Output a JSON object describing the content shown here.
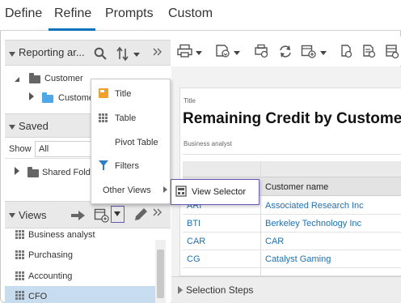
{
  "tabs": [
    "Define",
    "Refine",
    "Prompts",
    "Custom"
  ],
  "active_tab": "Refine",
  "left_panel": {
    "reporting_area": {
      "title": "Reporting ar...",
      "tree": [
        {
          "label": "Customer",
          "icon": "folder-icon"
        },
        {
          "label": "Custome",
          "icon": "folder-blue-icon"
        }
      ]
    },
    "saved": {
      "title": "Saved",
      "show_label": "Show",
      "show_value": "All",
      "tree": [
        {
          "label": "Shared Folde",
          "icon": "folder-icon"
        }
      ]
    },
    "views": {
      "title": "Views",
      "items": [
        "Business analyst",
        "Purchasing",
        "Accounting",
        "CFO"
      ],
      "selected": "CFO"
    }
  },
  "add_view_menu": {
    "items": [
      "Title",
      "Table",
      "Pivot Table",
      "Filters",
      "Other Views"
    ],
    "submenu": {
      "items": [
        "View Selector"
      ]
    }
  },
  "report": {
    "title_label": "Title",
    "title": "Remaining Credit by Customer",
    "subtitle": "Business analyst",
    "column_header": "Customer name",
    "rows": [
      {
        "code": "ARI",
        "name": "Associated Research Inc"
      },
      {
        "code": "BTI",
        "name": "Berkeley Technology Inc"
      },
      {
        "code": "CAR",
        "name": "CAR"
      },
      {
        "code": "CG",
        "name": "Catalyst Gaming"
      }
    ],
    "selection_steps_label": "Selection Steps"
  },
  "colors": {
    "accent": "#0e73b8",
    "link": "#1f6fb2",
    "highlight_border": "#6a55b8",
    "selected_row": "#c8dcef"
  }
}
